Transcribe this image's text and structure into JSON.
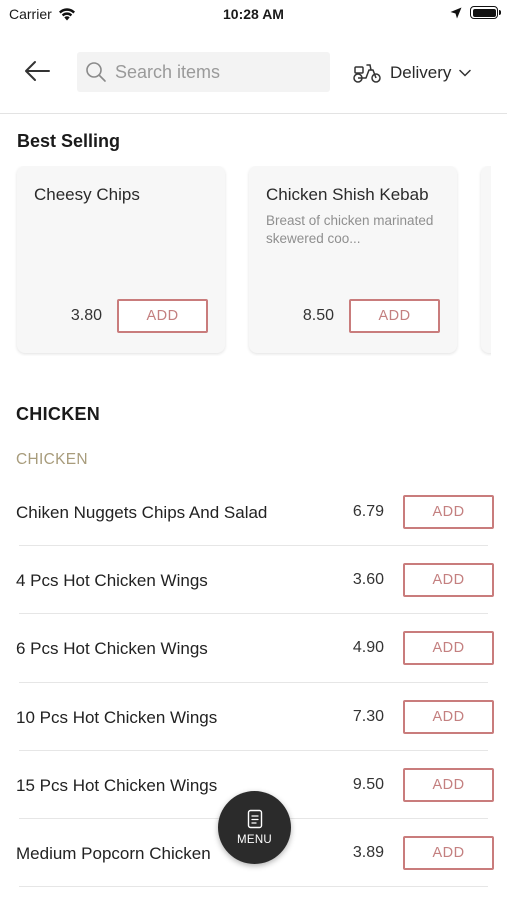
{
  "status_bar": {
    "carrier": "Carrier",
    "time": "10:28 AM"
  },
  "header": {
    "search_placeholder": "Search items",
    "delivery_label": "Delivery"
  },
  "best_selling": {
    "title": "Best Selling",
    "items": [
      {
        "name": "Cheesy Chips",
        "description": "",
        "price": "3.80",
        "add_label": "ADD"
      },
      {
        "name": "Chicken Shish Kebab",
        "description": "Breast of chicken marinated skewered coo...",
        "price": "8.50",
        "add_label": "ADD"
      }
    ]
  },
  "category": {
    "title": "CHICKEN",
    "subcategory": "CHICKEN",
    "items": [
      {
        "name": "Chiken Nuggets Chips And Salad",
        "price": "6.79",
        "add_label": "ADD"
      },
      {
        "name": "4 Pcs Hot Chicken Wings",
        "price": "3.60",
        "add_label": "ADD"
      },
      {
        "name": "6 Pcs Hot Chicken Wings",
        "price": "4.90",
        "add_label": "ADD"
      },
      {
        "name": "10 Pcs Hot Chicken Wings",
        "price": "7.30",
        "add_label": "ADD"
      },
      {
        "name": "15 Pcs Hot Chicken Wings",
        "price": "9.50",
        "add_label": "ADD"
      },
      {
        "name": "Medium Popcorn Chicken",
        "price": "3.89",
        "add_label": "ADD"
      }
    ]
  },
  "fab": {
    "label": "MENU",
    "icon": "menu-book-icon"
  },
  "colors": {
    "accent": "#c97c7c",
    "subcategory": "#a89c7c",
    "fab_bg": "#2b2b2b"
  }
}
